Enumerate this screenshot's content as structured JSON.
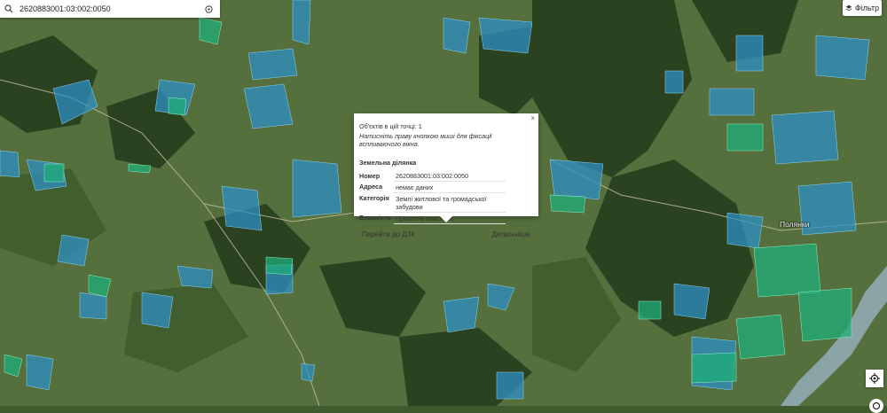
{
  "search": {
    "value": "2620883001:03:002:0050",
    "placeholder": ""
  },
  "filter": {
    "label": "Фільтр",
    "icon": "layers-icon"
  },
  "map": {
    "place_label": "Полянки",
    "colors": {
      "parcel_blue": "#2f8fc4",
      "parcel_green": "#1fae7a",
      "forest": "#2b4221",
      "meadow": "#58733f",
      "river": "#8aa4a8"
    }
  },
  "popup": {
    "close": "×",
    "count_text": "Об'єктів в цій точці: 1",
    "hint": "Натисніть праву кнопкою миші для фіксації вспливаючого вікна.",
    "section_title": "Земельна ділянка",
    "rows": [
      {
        "key": "Номер",
        "value": "2620883001:03:002:0050"
      },
      {
        "key": "Адреса",
        "value": "немає даних"
      },
      {
        "key": "Категорія",
        "value": "Землі житлової та громадської забудови"
      },
      {
        "key": "Власність",
        "value": "Приватна власність"
      }
    ],
    "action_left": "Перейти до ДЗК",
    "action_right": "Детальніше"
  },
  "controls": {
    "locate_icon": "crosshair-icon",
    "search_icon": "search-icon",
    "clear_icon": "info-icon"
  }
}
